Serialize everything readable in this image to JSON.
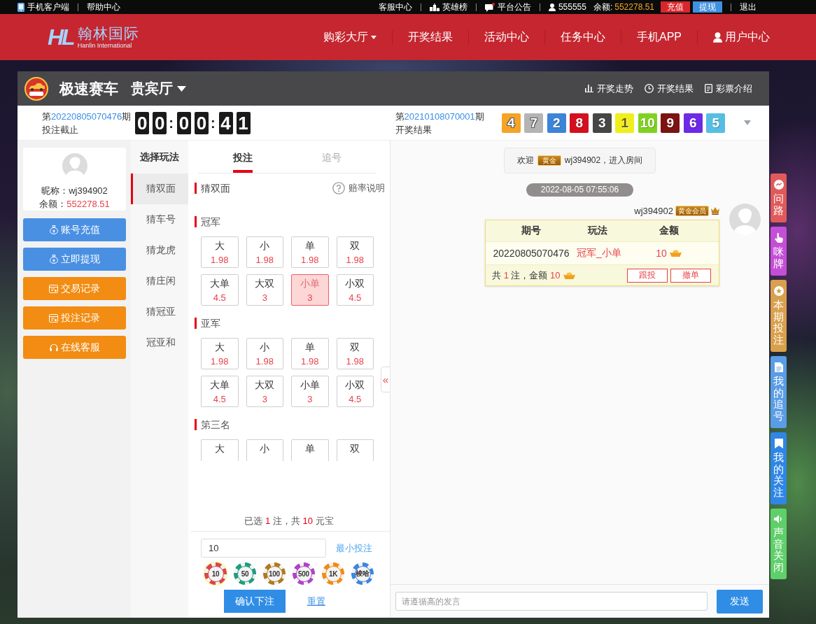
{
  "top_bar": {
    "left": [
      {
        "kind": "app",
        "label": "手机客户端"
      },
      {
        "kind": "help",
        "label": "帮助中心"
      }
    ],
    "right": [
      {
        "kind": "service",
        "label": "客服中心"
      },
      {
        "kind": "ranking",
        "label": "英雄榜"
      },
      {
        "kind": "notice",
        "label": "平台公告"
      },
      {
        "kind": "account",
        "label": "555555"
      }
    ],
    "balance_label": "余额:",
    "balance": "552278.51",
    "buttons": [
      {
        "kind": "deposit",
        "label": "充值"
      },
      {
        "kind": "withdraw",
        "label": "提现"
      }
    ],
    "logout": "退出"
  },
  "header": {
    "logo": {
      "mark": "HL",
      "name": "翰林国际",
      "subtitle": "Hanlin International"
    },
    "nav": [
      {
        "kind": "menu",
        "label": "购彩大厅"
      },
      {
        "kind": "link",
        "label": "开奖结果"
      },
      {
        "kind": "link",
        "label": "活动中心"
      },
      {
        "kind": "link",
        "label": "任务中心"
      },
      {
        "kind": "link",
        "label": "手机APP"
      },
      {
        "kind": "account",
        "label": "用户中心"
      }
    ]
  },
  "game": {
    "title": "极速赛车",
    "room": "贵宾厅",
    "links": [
      {
        "kind": "trend",
        "label": "开奖走势"
      },
      {
        "kind": "results",
        "label": "开奖结果"
      },
      {
        "kind": "intro",
        "label": "彩票介绍"
      }
    ]
  },
  "draw": {
    "current": {
      "prefix": "第",
      "issue": "20220805070476",
      "suffix": "期",
      "caption": "投注截止"
    },
    "countdown": [
      {
        "kind": "digit",
        "text": "0"
      },
      {
        "kind": "digit",
        "text": "0"
      },
      {
        "kind": "separator",
        "text": ":"
      },
      {
        "kind": "digit",
        "text": "0"
      },
      {
        "kind": "digit",
        "text": "0"
      },
      {
        "kind": "separator",
        "text": ":"
      },
      {
        "kind": "digit",
        "text": "4"
      },
      {
        "kind": "digit",
        "text": "1"
      }
    ],
    "last": {
      "prefix": "第",
      "issue": "20210108070001",
      "suffix": "期",
      "caption": "开奖结果"
    },
    "balls": [
      {
        "number": "4",
        "color": "#f5a425"
      },
      {
        "number": "7",
        "color": "#b4b4b4"
      },
      {
        "number": "2",
        "color": "#3b84d8"
      },
      {
        "number": "8",
        "color": "#d3101e"
      },
      {
        "number": "3",
        "color": "#464646"
      },
      {
        "number": "1",
        "color": "#f0ee1c"
      },
      {
        "number": "10",
        "color": "#7fd320"
      },
      {
        "number": "9",
        "color": "#7c1212"
      },
      {
        "number": "6",
        "color": "#6c2ae6"
      },
      {
        "number": "5",
        "color": "#57bde2"
      }
    ]
  },
  "account": {
    "nickname_label": "昵称：",
    "nickname": "wj394902",
    "balance_label": "余额：",
    "balance": "552278.51"
  },
  "side_buttons": [
    {
      "kind": "deposit",
      "label": "账号充值"
    },
    {
      "kind": "withdraw",
      "label": "立即提现"
    },
    {
      "kind": "transactions",
      "label": "交易记录"
    },
    {
      "kind": "bets",
      "label": "投注记录"
    },
    {
      "kind": "support",
      "label": "在线客服"
    }
  ],
  "play_types": {
    "title": "选择玩法",
    "items": [
      {
        "label": "猜双面",
        "selected": true
      },
      {
        "label": "猜车号",
        "selected": false
      },
      {
        "label": "猜龙虎",
        "selected": false
      },
      {
        "label": "猜庄闲",
        "selected": false
      },
      {
        "label": "猜冠亚",
        "selected": false
      },
      {
        "label": "冠亚和",
        "selected": false
      }
    ]
  },
  "bet_panel": {
    "tabs": [
      {
        "label": "投注",
        "selected": true
      },
      {
        "label": "追号",
        "selected": false
      }
    ],
    "section": "猜双面",
    "odds_help": "赔率说明",
    "groups": [
      {
        "title": "冠军",
        "options": [
          {
            "label": "大",
            "odds": "1.98",
            "selected": false
          },
          {
            "label": "小",
            "odds": "1.98",
            "selected": false
          },
          {
            "label": "单",
            "odds": "1.98",
            "selected": false
          },
          {
            "label": "双",
            "odds": "1.98",
            "selected": false
          },
          {
            "label": "大单",
            "odds": "4.5",
            "selected": false
          },
          {
            "label": "大双",
            "odds": "3",
            "selected": false
          },
          {
            "label": "小单",
            "odds": "3",
            "selected": true
          },
          {
            "label": "小双",
            "odds": "4.5",
            "selected": false
          }
        ]
      },
      {
        "title": "亚军",
        "options": [
          {
            "label": "大",
            "odds": "1.98",
            "selected": false
          },
          {
            "label": "小",
            "odds": "1.98",
            "selected": false
          },
          {
            "label": "单",
            "odds": "1.98",
            "selected": false
          },
          {
            "label": "双",
            "odds": "1.98",
            "selected": false
          },
          {
            "label": "大单",
            "odds": "4.5",
            "selected": false
          },
          {
            "label": "大双",
            "odds": "3",
            "selected": false
          },
          {
            "label": "小单",
            "odds": "3",
            "selected": false
          },
          {
            "label": "小双",
            "odds": "4.5",
            "selected": false
          }
        ]
      },
      {
        "title": "第三名",
        "options": [
          {
            "label": "大",
            "selected": false
          },
          {
            "label": "小",
            "selected": false
          },
          {
            "label": "单",
            "selected": false
          },
          {
            "label": "双",
            "selected": false
          }
        ]
      }
    ],
    "collapse": "«",
    "summary": {
      "before": "已选 ",
      "count": "1",
      "middle": " 注，共 ",
      "total": "10",
      "after": " 元宝"
    },
    "amount": "10",
    "min_bet": "最小投注",
    "chips": [
      {
        "label": "10",
        "color": "#d9474a",
        "selected": true
      },
      {
        "label": "50",
        "color": "#1e9e7e",
        "selected": false
      },
      {
        "label": "100",
        "color": "#b07a1e",
        "selected": false
      },
      {
        "label": "500",
        "color": "#b043c6",
        "selected": false
      },
      {
        "label": "1K",
        "color": "#f38b12",
        "selected": false
      },
      {
        "label": "梭哈",
        "color": "#3b86e0",
        "selected": false
      }
    ],
    "confirm": "确认下注",
    "reset": "重置"
  },
  "chat": {
    "welcome": {
      "label": "欢迎",
      "badge": "黄金",
      "message": "wj394902，进入房间"
    },
    "time": "2022-08-05 07:55:06",
    "message": {
      "user": "wj394902",
      "badge": "黄金会员",
      "columns": [
        "期号",
        "玩法",
        "金额"
      ],
      "rows": [
        {
          "issue": "20220805070476",
          "play": "冠军_小单",
          "amount": "10"
        }
      ],
      "summary": {
        "before": "共 ",
        "count": "1",
        "middle": " 注，金额 ",
        "amount": "10"
      },
      "actions": [
        "跟投",
        "撤单"
      ]
    },
    "input": {
      "placeholder": "请遵循高的发言"
    },
    "send": "发送"
  },
  "side_tabs": [
    {
      "kind": "roadmap",
      "label": "问路",
      "color": "#e05a5a"
    },
    {
      "kind": "squeeze",
      "label": "咪牌",
      "color": "#c44fd6"
    },
    {
      "kind": "current_bets",
      "label": "本期投注",
      "color": "#d9a04c"
    },
    {
      "kind": "chase",
      "label": "我的追号",
      "color": "#5a9ce6"
    },
    {
      "kind": "follow",
      "label": "我的关注",
      "color": "#2f86e6"
    },
    {
      "kind": "sound",
      "label": "声音关闭",
      "color": "#5fcf6a"
    }
  ]
}
